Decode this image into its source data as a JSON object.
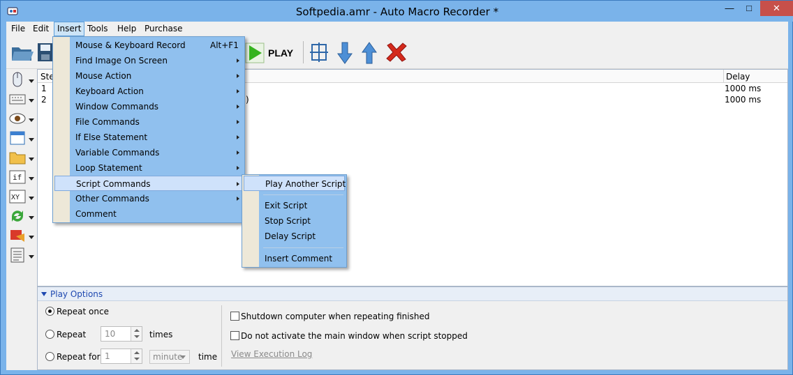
{
  "window": {
    "title": "Softpedia.amr - Auto Macro Recorder *",
    "minimize": "—",
    "maximize": "□",
    "close": "✕"
  },
  "menubar": {
    "items": [
      "File",
      "Edit",
      "Insert",
      "Tools",
      "Help",
      "Purchase"
    ]
  },
  "toolbar": {
    "play_label": "PLAY"
  },
  "list": {
    "columns": [
      "Step",
      "Delay"
    ],
    "rows": [
      {
        "step": "1",
        "action_tail": "",
        "delay": "1000 ms"
      },
      {
        "step": "2",
        "action_tail": ")",
        "delay": "1000 ms"
      }
    ]
  },
  "insert_menu": {
    "items": [
      {
        "label": "Mouse & Keyboard Record",
        "shortcut": "Alt+F1",
        "submenu": false
      },
      {
        "label": "Find Image On Screen",
        "shortcut": "",
        "submenu": true
      },
      {
        "label": "Mouse Action",
        "shortcut": "",
        "submenu": true
      },
      {
        "label": "Keyboard Action",
        "shortcut": "",
        "submenu": true
      },
      {
        "label": "Window Commands",
        "shortcut": "",
        "submenu": true
      },
      {
        "label": "File Commands",
        "shortcut": "",
        "submenu": true
      },
      {
        "label": "If Else Statement",
        "shortcut": "",
        "submenu": true
      },
      {
        "label": "Variable Commands",
        "shortcut": "",
        "submenu": true
      },
      {
        "label": "Loop Statement",
        "shortcut": "",
        "submenu": true
      },
      {
        "label": "Script Commands",
        "shortcut": "",
        "submenu": true
      },
      {
        "label": "Other Commands",
        "shortcut": "",
        "submenu": true
      },
      {
        "label": "Comment",
        "shortcut": "",
        "submenu": false
      }
    ],
    "highlighted": "Script Commands"
  },
  "script_submenu": {
    "items": [
      "Play Another Script",
      "Exit Script",
      "Stop Script",
      "Delay Script",
      "Insert Comment"
    ],
    "highlighted": "Play Another Script"
  },
  "play_options": {
    "title": "Play Options",
    "repeat_once": "Repeat once",
    "repeat": "Repeat",
    "repeat_count": "10",
    "times": "times",
    "repeat_for": "Repeat for",
    "repeat_for_value": "1",
    "repeat_for_unit": "minute",
    "time": "time",
    "selected": "repeat_once",
    "shutdown_label": "Shutdown computer when repeating finished",
    "shutdown_checked": false,
    "no_activate_label": "Do not activate the main window when script stopped",
    "no_activate_checked": false,
    "view_log": "View Execution Log"
  },
  "colors": {
    "menu_bg": "#90c0ee",
    "accent": "#1e48b0",
    "close_red": "#c7504a"
  }
}
